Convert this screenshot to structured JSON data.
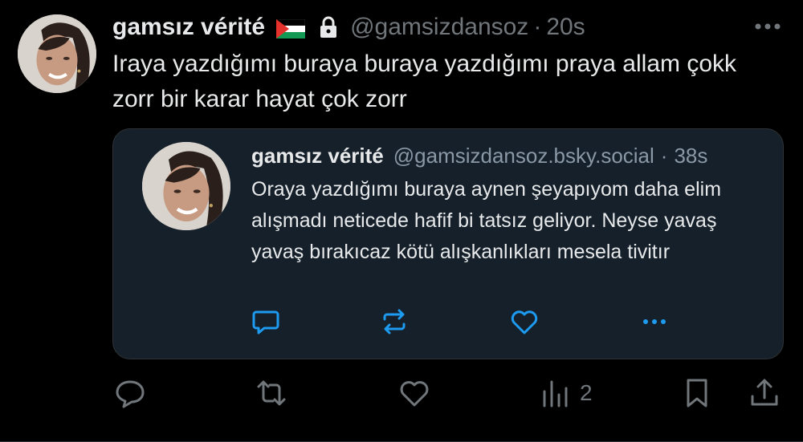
{
  "tweet": {
    "author_name": "gamsız vérité",
    "author_handle": "@gamsizdansoz",
    "separator": "·",
    "time": "20s",
    "text": "Iraya yazdığımı buraya buraya yazdığımı praya allam çokk zorr bir karar hayat çok zorr",
    "flag_icon": "palestine-flag-icon",
    "lock_icon": "lock-icon"
  },
  "quote": {
    "author_name": "gamsız vérité",
    "author_handle": "@gamsizdansoz.bsky.social",
    "separator": "·",
    "time": "38s",
    "text": "Oraya yazdığımı buraya aynen şeyapıyom daha elim alışmadı neticede hafif bi tatsız geliyor. Neyse yavaş yavaş bırakıcaz kötü alışkanlıkları mesela tivitır",
    "actions": [
      "comment-icon",
      "repost-icon",
      "like-icon",
      "more-icon"
    ]
  },
  "actions": {
    "views_count": "2",
    "items": [
      "reply-icon",
      "retweet-icon",
      "like-icon",
      "views-icon",
      "bookmark-icon",
      "share-icon"
    ]
  },
  "colors": {
    "background": "#000000",
    "text": "#e7e9ea",
    "muted": "#71767b",
    "quote_bg": "#15202b"
  }
}
